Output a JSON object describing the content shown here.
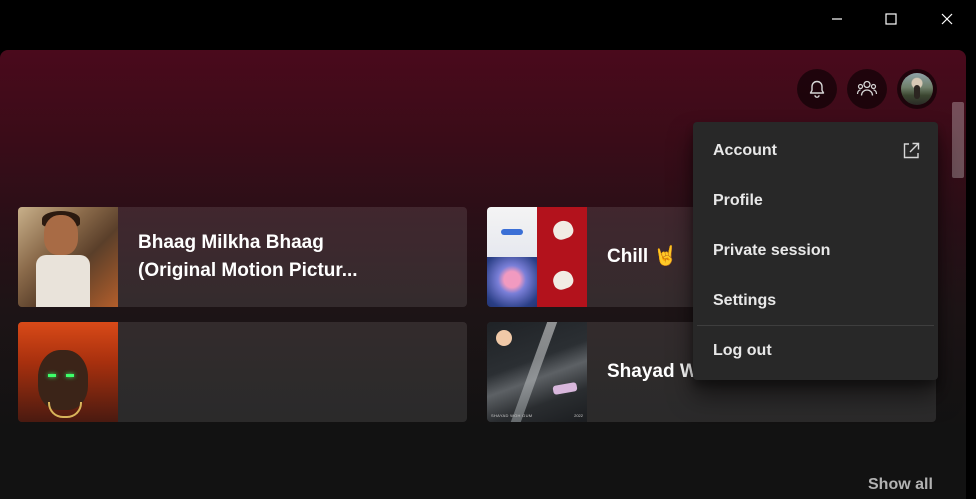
{
  "window_controls": {
    "minimize_icon": "minimize-icon",
    "maximize_icon": "maximize-icon",
    "close_icon": "close-icon"
  },
  "header": {
    "buttons": [
      "bell-icon",
      "friends-icon",
      "avatar"
    ]
  },
  "cards": [
    {
      "title": "Bhaag Milkha Bhaag\n(Original Motion Pictur...",
      "art": "bhaag-milkha-bhaag-cover"
    },
    {
      "title": "Chill 🤘",
      "art": "chill-collage-cover"
    },
    {
      "title": "",
      "art": "anime-character-cover"
    },
    {
      "title": "Shayad W",
      "art": "shayad-cover"
    }
  ],
  "shayad_cover_text": {
    "left": "SHAYAD WOH GUM",
    "right": "2022"
  },
  "section": {
    "show_all": "Show all"
  },
  "account_menu": {
    "items": [
      {
        "label": "Account",
        "icon": "external-link-icon"
      },
      {
        "label": "Profile"
      },
      {
        "label": "Private session"
      },
      {
        "label": "Settings"
      },
      {
        "label": "Log out"
      }
    ]
  },
  "colors": {
    "header_gradient_top": "#4a0a1c",
    "background": "#121212",
    "menu_bg": "#282828",
    "secondary_text": "#b3b3b3"
  }
}
